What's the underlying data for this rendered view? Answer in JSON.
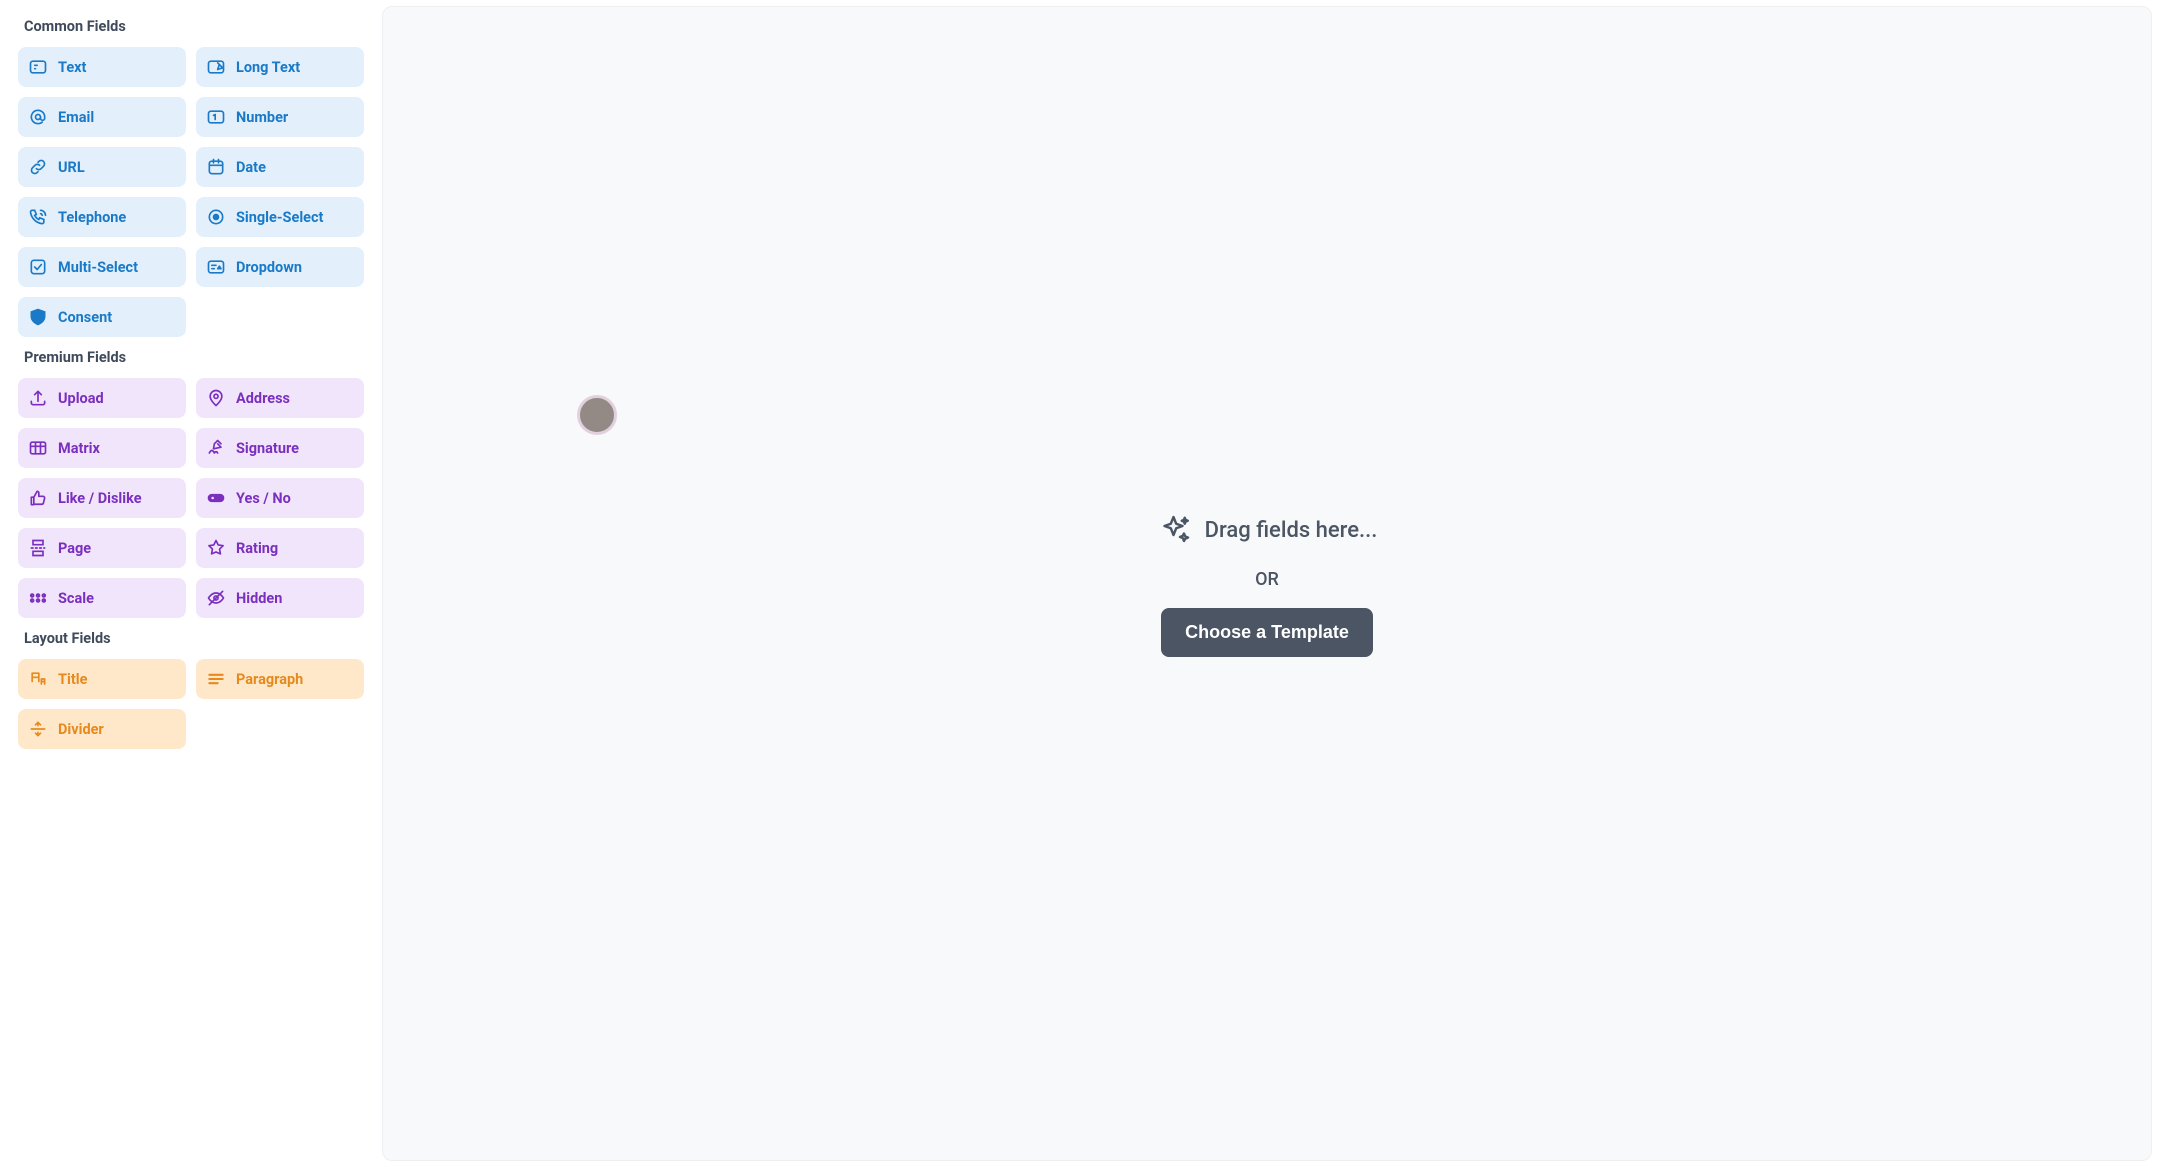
{
  "sections": {
    "common": {
      "label": "Common Fields",
      "fields": [
        {
          "id": "text",
          "label": "Text",
          "icon": "text-icon"
        },
        {
          "id": "long-text",
          "label": "Long Text",
          "icon": "long-text-icon"
        },
        {
          "id": "email",
          "label": "Email",
          "icon": "at-icon"
        },
        {
          "id": "number",
          "label": "Number",
          "icon": "number-icon"
        },
        {
          "id": "url",
          "label": "URL",
          "icon": "link-icon"
        },
        {
          "id": "date",
          "label": "Date",
          "icon": "calendar-icon"
        },
        {
          "id": "telephone",
          "label": "Telephone",
          "icon": "phone-icon"
        },
        {
          "id": "single-select",
          "label": "Single-Select",
          "icon": "radio-icon"
        },
        {
          "id": "multi-select",
          "label": "Multi-Select",
          "icon": "checkbox-icon"
        },
        {
          "id": "dropdown",
          "label": "Dropdown",
          "icon": "dropdown-icon"
        },
        {
          "id": "consent",
          "label": "Consent",
          "icon": "shield-icon"
        }
      ]
    },
    "premium": {
      "label": "Premium Fields",
      "fields": [
        {
          "id": "upload",
          "label": "Upload",
          "icon": "upload-icon"
        },
        {
          "id": "address",
          "label": "Address",
          "icon": "pin-icon"
        },
        {
          "id": "matrix",
          "label": "Matrix",
          "icon": "table-icon"
        },
        {
          "id": "signature",
          "label": "Signature",
          "icon": "signature-icon"
        },
        {
          "id": "like-dislike",
          "label": "Like / Dislike",
          "icon": "thumbs-icon"
        },
        {
          "id": "yes-no",
          "label": "Yes / No",
          "icon": "toggle-icon"
        },
        {
          "id": "page",
          "label": "Page",
          "icon": "page-break-icon"
        },
        {
          "id": "rating",
          "label": "Rating",
          "icon": "star-icon"
        },
        {
          "id": "scale",
          "label": "Scale",
          "icon": "scale-icon"
        },
        {
          "id": "hidden",
          "label": "Hidden",
          "icon": "eye-off-icon"
        }
      ]
    },
    "layout": {
      "label": "Layout Fields",
      "fields": [
        {
          "id": "title",
          "label": "Title",
          "icon": "heading-icon"
        },
        {
          "id": "paragraph",
          "label": "Paragraph",
          "icon": "paragraph-icon"
        },
        {
          "id": "divider",
          "label": "Divider",
          "icon": "divider-icon"
        }
      ]
    }
  },
  "canvas": {
    "drag_hint": "Drag fields here...",
    "or": "OR",
    "template_button": "Choose a Template"
  }
}
